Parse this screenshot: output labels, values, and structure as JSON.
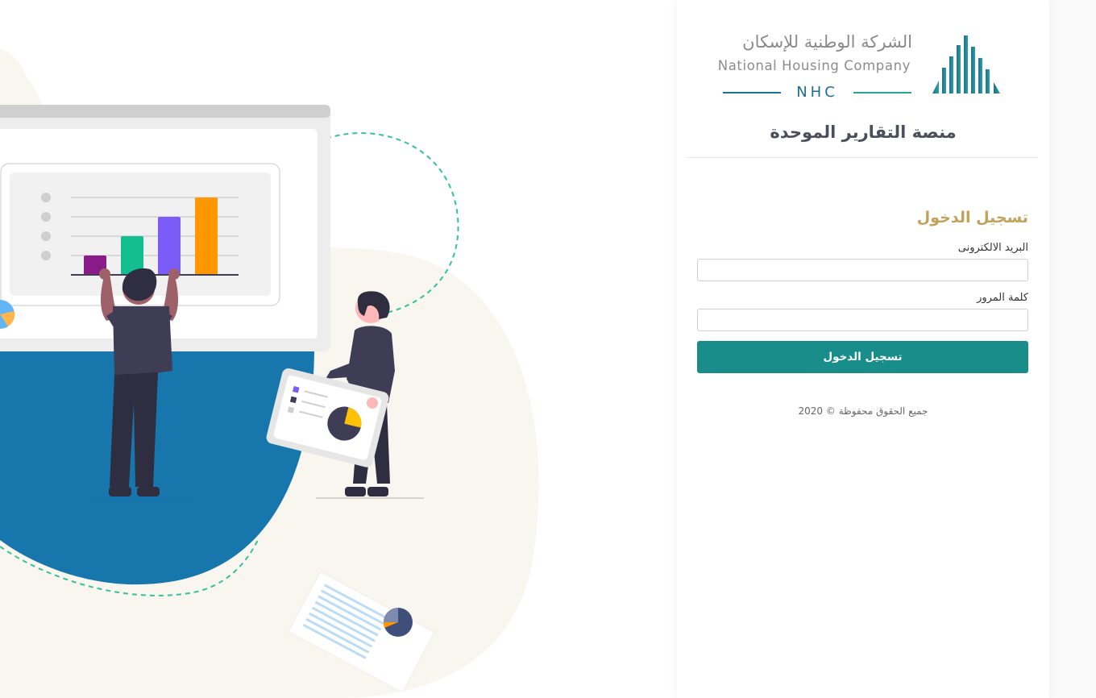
{
  "brand": {
    "name_ar": "الشركة الوطنية للإسكان",
    "name_en": "National Housing Company",
    "abbr": "NHC",
    "colors": {
      "blue": "#1c6f97",
      "teal": "#188d8a",
      "gold": "#c2a15a"
    }
  },
  "platform_title": "منصة التقارير الموحدة",
  "login": {
    "title": "تسجيل الدخول",
    "email_label": "البريد الالكترونى",
    "email_value": "",
    "password_label": "كلمة المرور",
    "password_value": "",
    "submit_label": "تسجيل الدخول"
  },
  "footer": "جميع الحقوق محفوظة © 2020",
  "illustration": {
    "bar_colors": [
      "#8b1a89",
      "#13bf8e",
      "#7c5cf6",
      "#ff9800"
    ],
    "bar_values": [
      0.25,
      0.5,
      0.75,
      1.0
    ]
  }
}
